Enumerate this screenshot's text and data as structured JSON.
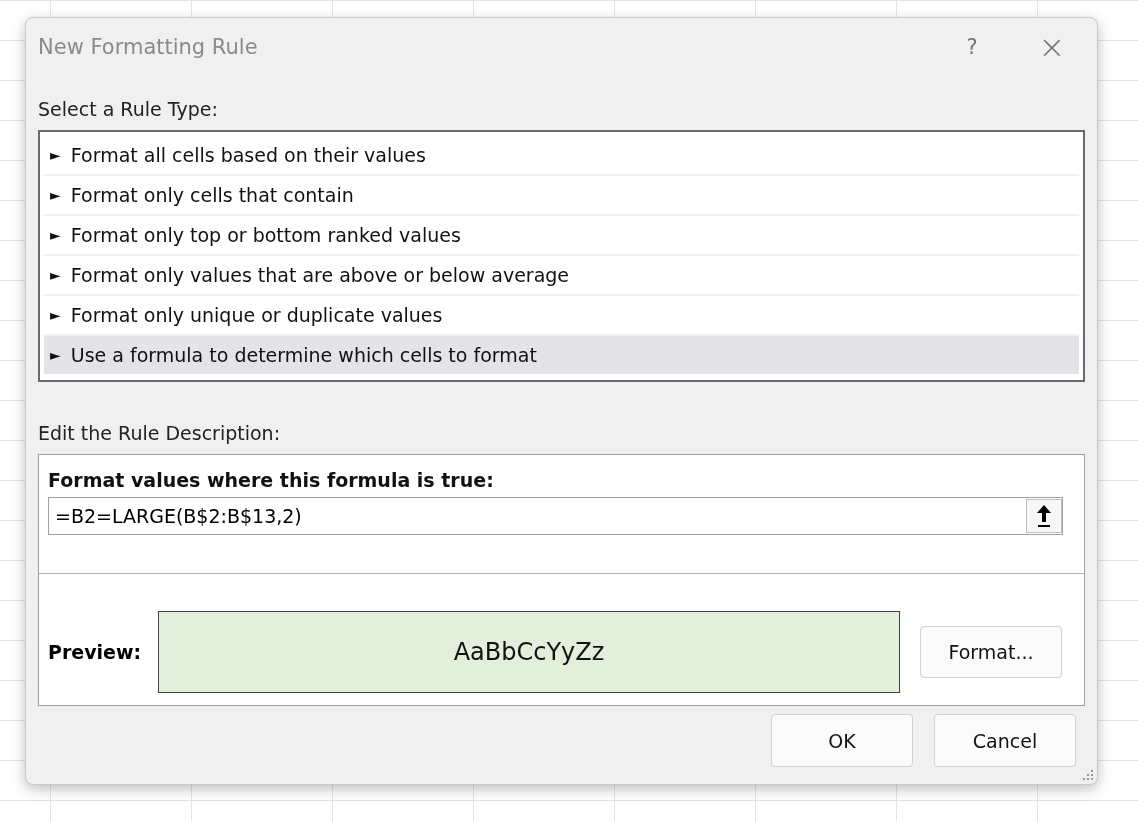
{
  "window": {
    "title": "New Formatting Rule",
    "help": "?",
    "close": "×"
  },
  "rule_type": {
    "label": "Select a Rule Type:",
    "items": [
      {
        "arrow": "►",
        "label": "Format all cells based on their values",
        "selected": false
      },
      {
        "arrow": "►",
        "label": "Format only cells that contain",
        "selected": false
      },
      {
        "arrow": "►",
        "label": "Format only top or bottom ranked values",
        "selected": false
      },
      {
        "arrow": "►",
        "label": "Format only values that are above or below average",
        "selected": false
      },
      {
        "arrow": "►",
        "label": "Format only unique or duplicate values",
        "selected": false
      },
      {
        "arrow": "►",
        "label": "Use a formula to determine which cells to format",
        "selected": true
      }
    ]
  },
  "description": {
    "label": "Edit the Rule Description:",
    "formula_label": "Format values where this formula is true:",
    "formula": "=B2=LARGE(B$2:B$13,2)",
    "preview_label": "Preview:",
    "preview_text": "AaBbCcYyZz",
    "format_button": "Format..."
  },
  "buttons": [
    "OK",
    "Cancel"
  ]
}
